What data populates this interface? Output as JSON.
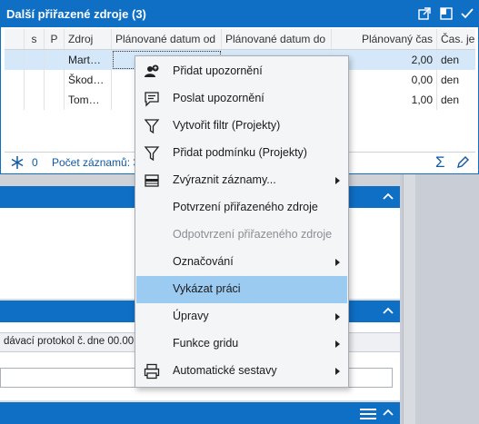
{
  "window": {
    "title": "Další přiřazené zdroje (3)"
  },
  "grid": {
    "columns": [
      "s",
      "P",
      "Zdroj",
      "Plánované datum od",
      "Plánované datum do",
      "Plánovaný čas",
      "Čas. je"
    ],
    "rows": [
      {
        "zdroj": "Mart…",
        "cas": "2,00",
        "jed": "den",
        "selected": true
      },
      {
        "zdroj": "Škod…",
        "cas": "0,00",
        "jed": "den",
        "selected": false
      },
      {
        "zdroj": "Tom…",
        "cas": "1,00",
        "jed": "den",
        "selected": false
      }
    ]
  },
  "status": {
    "count": "0",
    "records_label": "Počet záznamů: 3"
  },
  "background": {
    "field_row_left": "dávací protokol č.",
    "field_row_right": "dne 00.00"
  },
  "context_menu": {
    "items": [
      {
        "label": "Přidat upozornění",
        "icon": "add-notification-icon",
        "enabled": true,
        "submenu": false
      },
      {
        "label": "Poslat upozornění",
        "icon": "message-icon",
        "enabled": true,
        "submenu": false
      },
      {
        "label": "Vytvořit filtr (Projekty)",
        "icon": "filter-icon",
        "enabled": true,
        "submenu": false
      },
      {
        "label": "Přidat podmínku (Projekty)",
        "icon": "filter-add-icon",
        "enabled": true,
        "submenu": false
      },
      {
        "label": "Zvýraznit záznamy...",
        "icon": "highlight-icon",
        "enabled": true,
        "submenu": true
      },
      {
        "label": "Potvrzení přiřazeného zdroje",
        "icon": "",
        "enabled": true,
        "submenu": false
      },
      {
        "label": "Odpotvrzení přiřazeného zdroje",
        "icon": "",
        "enabled": false,
        "submenu": false
      },
      {
        "label": "Označování",
        "icon": "",
        "enabled": true,
        "submenu": true
      },
      {
        "label": "Vykázat práci",
        "icon": "",
        "enabled": true,
        "submenu": false,
        "highlighted": true
      },
      {
        "label": "Úpravy",
        "icon": "",
        "enabled": true,
        "submenu": true
      },
      {
        "label": "Funkce gridu",
        "icon": "",
        "enabled": true,
        "submenu": true
      },
      {
        "label": "Automatické sestavy",
        "icon": "printer-icon",
        "enabled": true,
        "submenu": true
      }
    ]
  },
  "colors": {
    "accent": "#0e6fc4",
    "selected_row": "#d4e8fa",
    "menu_highlight": "#9ccbf2"
  }
}
